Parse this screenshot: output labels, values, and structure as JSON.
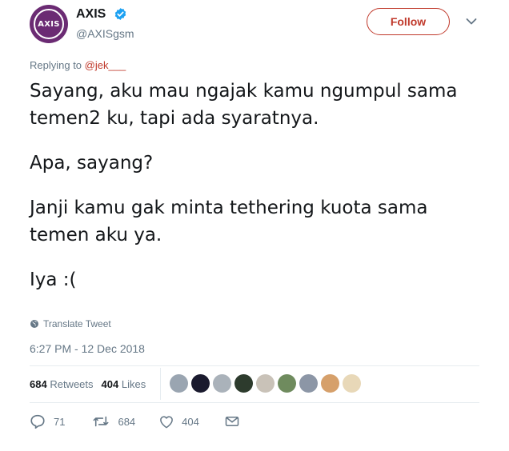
{
  "author": {
    "avatar_text": "AXIS",
    "name": "AXIS",
    "handle": "@AXISgsm",
    "follow_label": "Follow"
  },
  "reply": {
    "prefix": "Replying to",
    "mention": "@jek___"
  },
  "tweet": {
    "paragraphs": [
      "Sayang, aku mau ngajak kamu ngumpul sama temen2 ku, tapi ada syaratnya.",
      "Apa, sayang?",
      "Janji kamu gak minta tethering kuota sama temen aku ya.",
      "Iya :("
    ],
    "translate_label": "Translate Tweet",
    "timestamp": "6:27 PM - 12 Dec 2018"
  },
  "stats": {
    "retweets_count": "684",
    "retweets_label": "Retweets",
    "likes_count": "404",
    "likes_label": "Likes"
  },
  "liker_avatars": [
    "#9aa5b1",
    "#1a1a2e",
    "#aab2ba",
    "#2d3b2d",
    "#c9c2b8",
    "#6f8b5e",
    "#8c96a6",
    "#d6a06b",
    "#e8d8b8"
  ],
  "actions": {
    "reply_count": "71",
    "retweet_count": "684",
    "like_count": "404"
  },
  "colors": {
    "brand": "#6b2b73",
    "accent": "#c0392b",
    "verified": "#1da1f2",
    "muted": "#657786"
  }
}
